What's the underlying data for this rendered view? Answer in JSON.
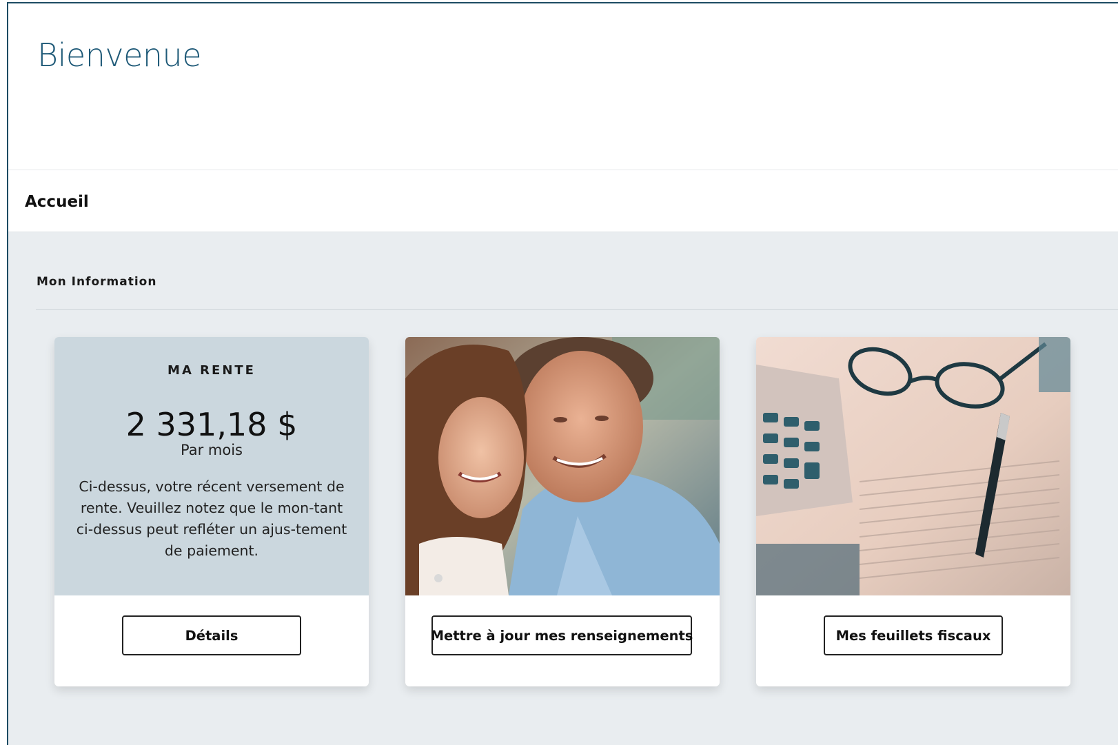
{
  "header": {
    "title": "Bienvenue"
  },
  "breadcrumb": {
    "label": "Accueil"
  },
  "section": {
    "title": "Mon Information"
  },
  "cards": {
    "rente": {
      "title": "MA RENTE",
      "amount": "2 331,18 $",
      "period": "Par mois",
      "description": "Ci-dessus, votre récent versement de rente. Veuillez notez que le mon-tant ci-dessus peut refléter un ajus-tement de paiement.",
      "button": "Détails"
    },
    "profile": {
      "image": "couple-photo",
      "button": "Mettre à jour mes renseignements"
    },
    "tax": {
      "image": "tax-documents-photo",
      "button": "Mes feuillets fiscaux"
    }
  },
  "colors": {
    "title": "#1f5a78",
    "background": "#e9edf0",
    "rente_card": "#cbd7de",
    "frame_border": "#1d4b63"
  }
}
